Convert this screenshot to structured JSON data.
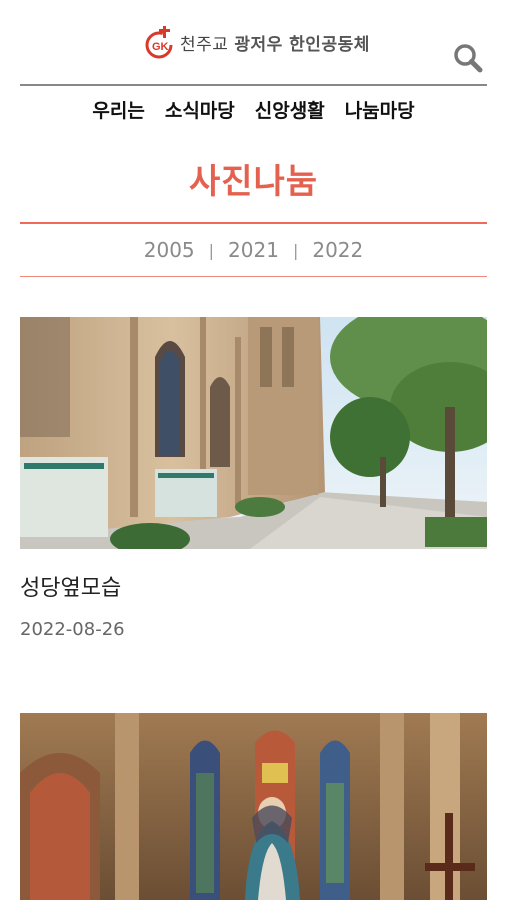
{
  "header": {
    "logo_mark": "GK",
    "logo_text_prefix": "천주교",
    "logo_text_main": "광저우 한인공동체",
    "search_icon": "search-icon"
  },
  "nav": {
    "items": [
      {
        "label": "우리는"
      },
      {
        "label": "소식마당"
      },
      {
        "label": "신앙생활"
      },
      {
        "label": "나눔마당"
      }
    ]
  },
  "page": {
    "title": "사진나눔",
    "years": [
      "2005",
      "2021",
      "2022"
    ],
    "year_separator": "|"
  },
  "posts": [
    {
      "title": "성당옆모습",
      "date": "2022-08-26"
    },
    {
      "title": "",
      "date": ""
    }
  ],
  "colors": {
    "accent_red": "#e5614f",
    "rule_gray": "#888888"
  }
}
